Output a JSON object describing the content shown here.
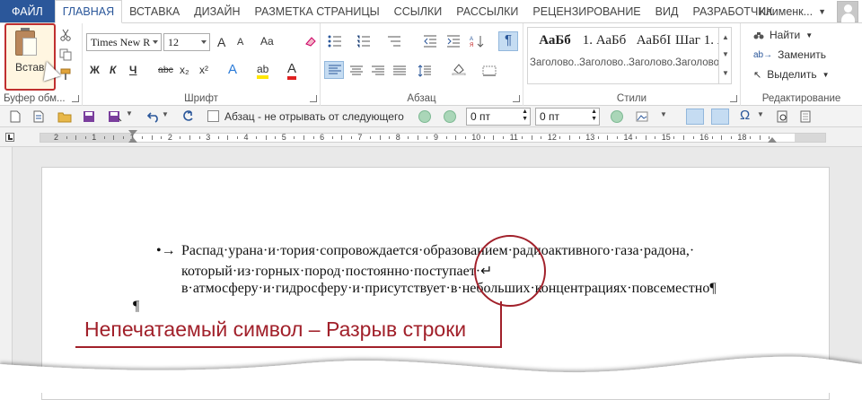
{
  "tabs": [
    "ФАЙЛ",
    "ГЛАВНАЯ",
    "ВСТАВКА",
    "ДИЗАЙН",
    "РАЗМЕТКА СТРАНИЦЫ",
    "ССЫЛКИ",
    "РАССЫЛКИ",
    "РЕЦЕНЗИРОВАНИЕ",
    "ВИД",
    "РАЗРАБОТЧИК"
  ],
  "user": "Клименк...",
  "clipboard": {
    "paste_label": "Встав",
    "group_label": "Буфер обм..."
  },
  "font": {
    "name": "Times New R",
    "size": "12",
    "group_label": "Шрифт",
    "bold": "Ж",
    "italic": "К",
    "underline": "Ч",
    "strike": "abc",
    "sub": "x₂",
    "sup": "x²",
    "grow": "A",
    "shrink": "A",
    "case": "Aa",
    "effects": "A",
    "highlight": "ab",
    "color": "A"
  },
  "paragraph": {
    "group_label": "Абзац",
    "pilcrow": "¶"
  },
  "styles": {
    "group_label": "Стили",
    "items": [
      {
        "sample": "АаБб",
        "name": "Заголово..."
      },
      {
        "sample": "1. АаБб",
        "name": "Заголово..."
      },
      {
        "sample": "АаБбI",
        "name": "Заголово..."
      },
      {
        "sample": "Шаг 1. А",
        "name": "Заголово..."
      }
    ]
  },
  "editing": {
    "group_label": "Редактирование",
    "find": "Найти",
    "replace": "Заменить",
    "select": "Выделить"
  },
  "qat": {
    "keep_label": "Абзац - не отрывать от следующего",
    "spacing_before": "0 пт",
    "spacing_after": "0 пт",
    "omega": "Ω"
  },
  "ruler": {
    "numbers": [
      "2",
      "1",
      "1",
      "2",
      "3",
      "4",
      "5",
      "6",
      "7",
      "8",
      "9",
      "10",
      "11",
      "12",
      "13",
      "14",
      "15",
      "16",
      "18"
    ]
  },
  "document": {
    "line1": "Распад·урана·и·тория·сопровождается·образованием·радиоактивного·газа·радона,·",
    "line2": "который·из·горных·пород·постоянно·поступает·↵",
    "line3": "в·атмосферу·и·гидросферу·и·присутствует·в·небольших·концентрациях·повсеместно¶",
    "empty": "¶",
    "bullet": "•→"
  },
  "callout": "Непечатаемый символ – Разрыв строки",
  "colors": {
    "accent": "#2b579a",
    "callout": "#a1202a"
  }
}
